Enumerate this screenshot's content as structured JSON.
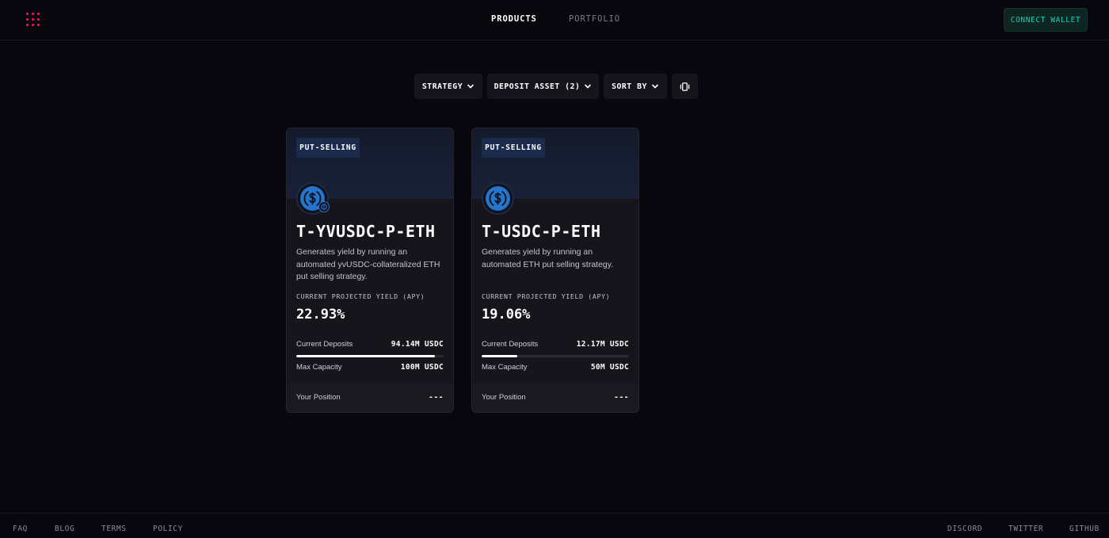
{
  "header": {
    "logo_icon": "dot-grid-logo",
    "nav": {
      "products": "PRODUCTS",
      "portfolio": "PORTFOLIO"
    },
    "connect_wallet": "CONNECT WALLET"
  },
  "filters": {
    "strategy": "STRATEGY",
    "deposit_asset": "DEPOSIT ASSET (2)",
    "sort_by": "SORT BY",
    "view_toggle_icon": "carousel-view-icon"
  },
  "vaults": [
    {
      "tag": "PUT-SELLING",
      "title": "T-YVUSDC-P-ETH",
      "description": "Generates yield by running an automated yvUSDC-collateralized ETH put selling strategy.",
      "yield_label": "CURRENT PROJECTED YIELD (APY)",
      "yield_value": "22.93%",
      "deposits_label": "Current Deposits",
      "deposits_value": "94.14M USDC",
      "capacity_label": "Max Capacity",
      "capacity_value": "100M USDC",
      "deposit_progress": 0.9414,
      "position_label": "Your Position",
      "position_value": "---"
    },
    {
      "tag": "PUT-SELLING",
      "title": "T-USDC-P-ETH",
      "description": "Generates yield by running an automated ETH put selling strategy.",
      "yield_label": "CURRENT PROJECTED YIELD (APY)",
      "yield_value": "19.06%",
      "deposits_label": "Current Deposits",
      "deposits_value": "12.17M USDC",
      "capacity_label": "Max Capacity",
      "capacity_value": "50M USDC",
      "deposit_progress": 0.2434,
      "position_label": "Your Position",
      "position_value": "---"
    }
  ],
  "footer": {
    "faq": "FAQ",
    "blog": "BLOG",
    "terms": "TERMS",
    "policy": "POLICY",
    "discord": "DISCORD",
    "twitter": "TWITTER",
    "github": "GITHUB"
  },
  "colors": {
    "background": "#08070d",
    "accent_logo": "#fc0a54",
    "connect_text": "#16ceb9",
    "usdc_blue": "#2775ca"
  }
}
